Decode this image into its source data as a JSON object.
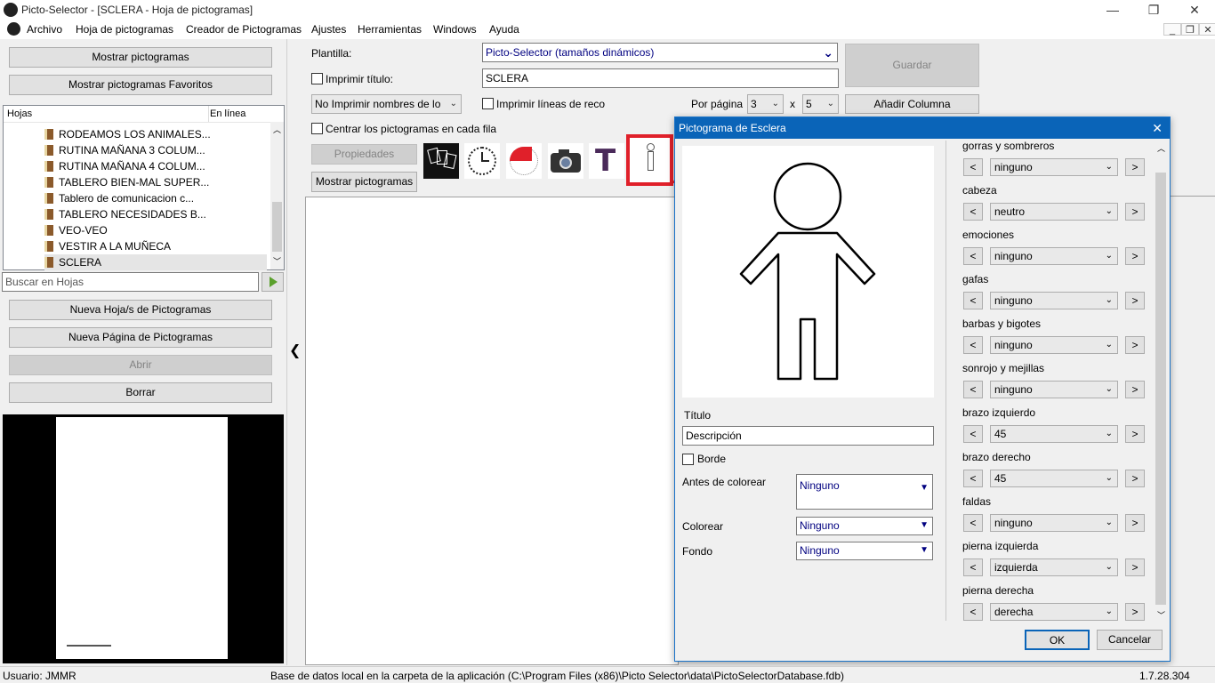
{
  "window": {
    "title": "Picto-Selector - [SCLERA - Hoja de pictogramas]",
    "minimize": "—",
    "restore": "❐",
    "close": "✕"
  },
  "menu": {
    "items": [
      "Archivo",
      "Hoja de pictogramas",
      "Creador de Pictogramas",
      "Ajustes",
      "Herramientas",
      "Windows",
      "Ayuda"
    ]
  },
  "left": {
    "btn_show": "Mostrar pictogramas",
    "btn_show_fav": "Mostrar pictogramas Favoritos",
    "col_sheets": "Hojas",
    "col_online": "En línea",
    "tree": [
      "RODEAMOS LOS ANIMALES...",
      "RUTINA MAÑANA 3 COLUM...",
      "RUTINA MAÑANA 4 COLUM...",
      "TABLERO BIEN-MAL SUPER...",
      "Tablero de comunicacion c...",
      "TABLERO NECESIDADES B...",
      "VEO-VEO",
      "VESTIR A LA MUÑECA",
      "SCLERA"
    ],
    "search_placeholder": "Buscar en Hojas",
    "btn_new_sheet": "Nueva Hoja/s de Pictogramas",
    "btn_new_page": "Nueva Página de Pictogramas",
    "btn_open": "Abrir",
    "btn_delete": "Borrar"
  },
  "top": {
    "template_label": "Plantilla:",
    "template_value": "Picto-Selector (tamaños dinámicos)",
    "save": "Guardar",
    "print_title_label": "Imprimir título:",
    "title_value": "SCLERA",
    "no_print_names": "No Imprimir nombres de lo",
    "print_lines": "Imprimir líneas de reco",
    "per_page": "Por página",
    "rows": "3",
    "x": "x",
    "cols": "5",
    "add_column": "Añadir Columna",
    "center_label": "Centrar los pictogramas en cada fila",
    "properties": "Propiedades",
    "show_picts": "Mostrar pictogramas",
    "collapse": "❮"
  },
  "dialog": {
    "title": "Pictograma de Esclera",
    "close": "✕",
    "titulo_label": "Título",
    "titulo_value": "Descripción",
    "borde_label": "Borde",
    "antes_label": "Antes de colorear",
    "antes_value": "Ninguno",
    "colorear_label": "Colorear",
    "colorear_value": "Ninguno",
    "fondo_label": "Fondo",
    "fondo_value": "Ninguno",
    "ok": "OK",
    "cancel": "Cancelar",
    "props": [
      {
        "label": "gorras y sombreros",
        "value": "ninguno"
      },
      {
        "label": "cabeza",
        "value": "neutro"
      },
      {
        "label": "emociones",
        "value": "ninguno"
      },
      {
        "label": "gafas",
        "value": "ninguno"
      },
      {
        "label": "barbas y bigotes",
        "value": "ninguno"
      },
      {
        "label": "sonrojo y mejillas",
        "value": "ninguno"
      },
      {
        "label": "brazo izquierdo",
        "value": "45"
      },
      {
        "label": "brazo derecho",
        "value": "45"
      },
      {
        "label": "faldas",
        "value": "ninguno"
      },
      {
        "label": "pierna izquierda",
        "value": "izquierda"
      },
      {
        "label": "pierna derecha",
        "value": "derecha"
      }
    ],
    "prev": "<",
    "next": ">"
  },
  "status": {
    "user": "Usuario: JMMR",
    "db": "Base de datos local en la carpeta de la aplicación (C:\\Program Files (x86)\\Picto Selector\\data\\PictoSelectorDatabase.fdb)",
    "version": "1.7.28.304"
  },
  "colors": {
    "accent": "#0a64b8",
    "highlight_red": "#e0202a"
  }
}
